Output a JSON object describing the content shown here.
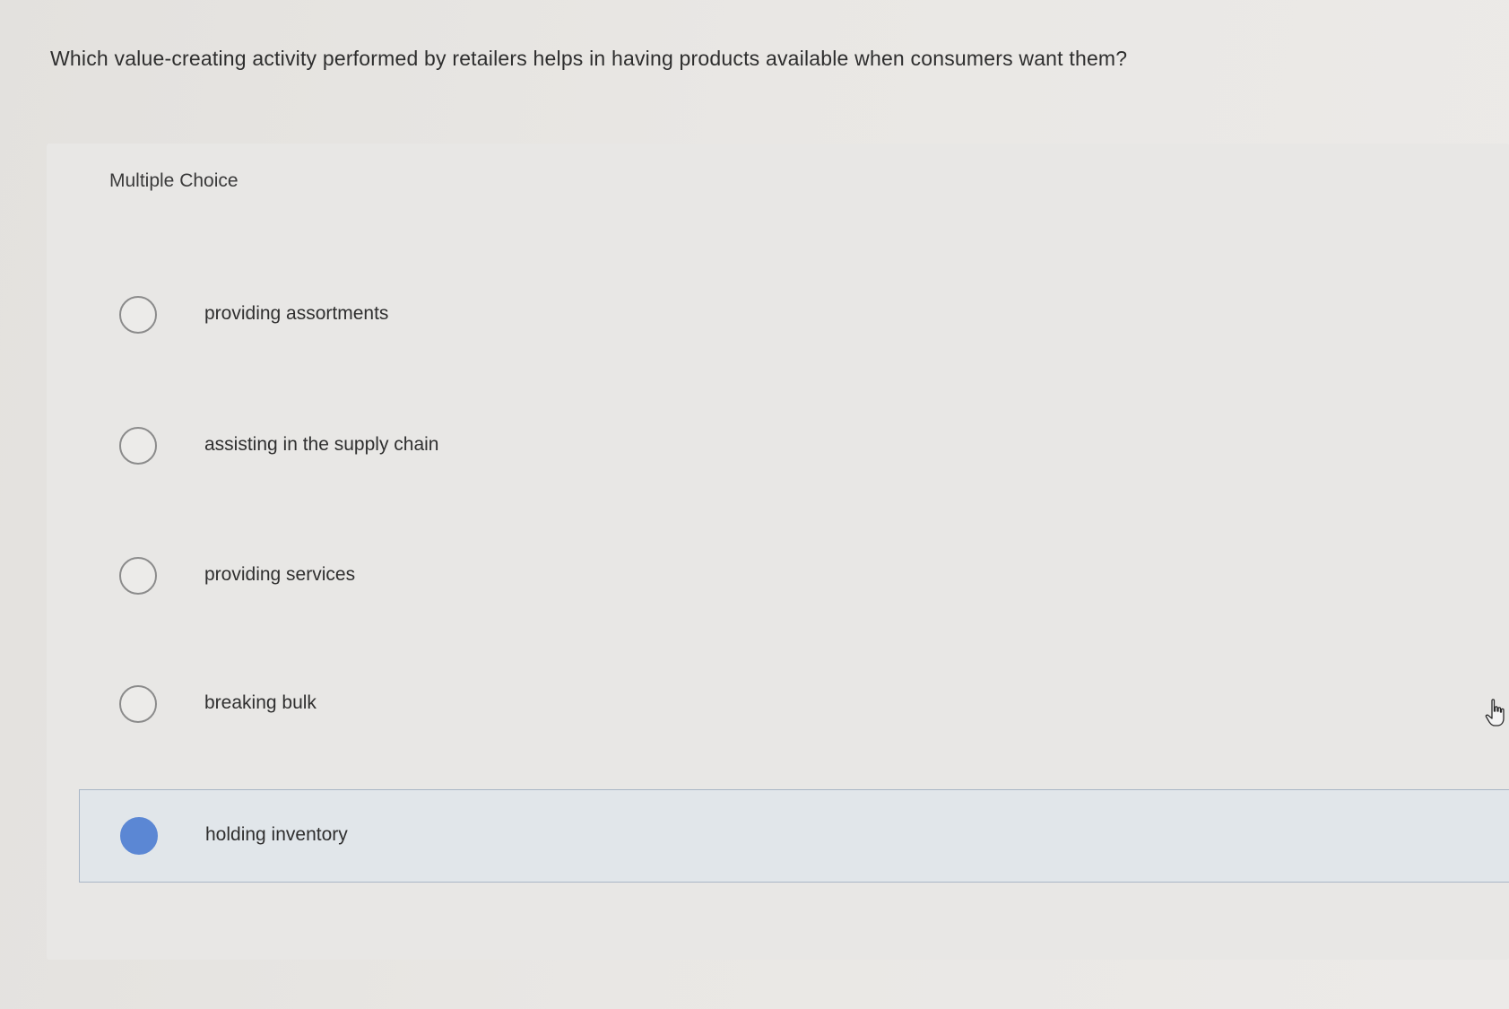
{
  "question": {
    "text": "Which value-creating activity performed by retailers helps in having products available when consumers want them?"
  },
  "panel": {
    "type_label": "Multiple Choice"
  },
  "options": [
    {
      "label": "providing assortments",
      "selected": false
    },
    {
      "label": "assisting in the supply chain",
      "selected": false
    },
    {
      "label": "providing services",
      "selected": false
    },
    {
      "label": "breaking bulk",
      "selected": false
    },
    {
      "label": "holding inventory",
      "selected": true
    }
  ],
  "colors": {
    "selected_radio": "#5b87d4",
    "selected_row_bg": "#e1e6ea"
  },
  "icons": {
    "cursor": "hand-pointer-icon",
    "radio": "radio-circle-icon"
  }
}
